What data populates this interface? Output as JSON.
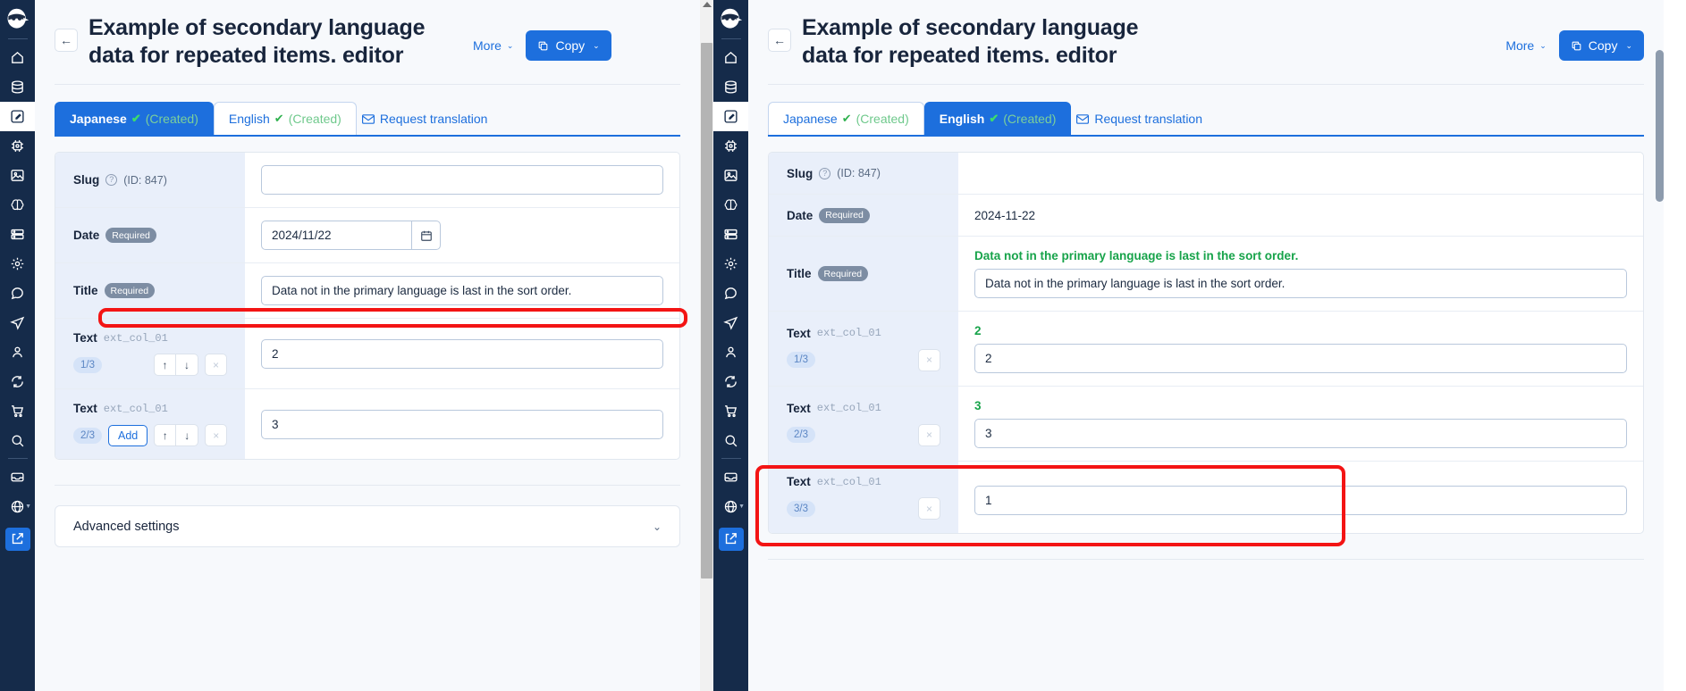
{
  "sidebar": {
    "logo": "ninja-logo",
    "items": [
      {
        "icon": "home-icon",
        "name": "home",
        "active": false
      },
      {
        "icon": "database-icon",
        "name": "database",
        "active": false
      },
      {
        "icon": "edit-square-icon",
        "name": "editor",
        "active": true
      },
      {
        "icon": "chip-icon",
        "name": "chip",
        "active": false
      },
      {
        "icon": "image-icon",
        "name": "media",
        "active": false
      },
      {
        "icon": "brain-icon",
        "name": "ai",
        "active": false
      },
      {
        "icon": "server-icon",
        "name": "server",
        "active": false
      },
      {
        "icon": "gear-icon",
        "name": "settings",
        "active": false
      },
      {
        "icon": "chat-icon",
        "name": "chat",
        "active": false
      },
      {
        "icon": "send-icon",
        "name": "send",
        "active": false
      },
      {
        "icon": "user-icon",
        "name": "user",
        "active": false
      },
      {
        "icon": "sync-icon",
        "name": "sync",
        "active": false
      },
      {
        "icon": "cart-icon",
        "name": "cart",
        "active": false
      },
      {
        "icon": "search-icon",
        "name": "search",
        "active": false
      },
      {
        "icon": "inbox-icon",
        "name": "inbox",
        "active": false
      },
      {
        "icon": "globe-icon",
        "name": "language",
        "active": false
      },
      {
        "icon": "external-link-icon",
        "name": "open-external",
        "active": false
      }
    ]
  },
  "header": {
    "title": "Example of secondary language data for repeated items. editor",
    "back_label": "←",
    "more_label": "More",
    "more_chevron": "⌄",
    "copy_label": "Copy",
    "copy_chevron": "⌄"
  },
  "tabs": {
    "japanese": {
      "label": "Japanese",
      "check": "✔",
      "status": "(Created)"
    },
    "english": {
      "label": "English",
      "check": "✔",
      "status": "(Created)"
    },
    "request": {
      "label": "Request translation"
    }
  },
  "left_panel": {
    "active_tab": "Japanese",
    "rows": [
      {
        "label": "Slug",
        "help": "?",
        "id_text": "(ID: 847)",
        "required": false,
        "value": "",
        "kind": "text"
      },
      {
        "label": "Date",
        "required_badge": "Required",
        "value": "2024/11/22",
        "kind": "date"
      },
      {
        "label": "Title",
        "required_badge": "Required",
        "value": "Data not in the primary language is last in the sort order.",
        "kind": "text"
      },
      {
        "label": "Text",
        "code": "ext_col_01",
        "index": "1/3",
        "add_label": null,
        "up": "↑",
        "down": "↓",
        "remove": "×",
        "value": "2",
        "kind": "repeat"
      },
      {
        "label": "Text",
        "code": "ext_col_01",
        "index": "2/3",
        "add_label": "Add",
        "up": "↑",
        "down": "↓",
        "remove": "×",
        "value": "3",
        "kind": "repeat"
      }
    ],
    "advanced_settings": {
      "title": "Advanced settings",
      "chevron": "⌄"
    }
  },
  "right_panel": {
    "active_tab": "English",
    "rows": [
      {
        "label": "Slug",
        "help": "?",
        "id_text": "(ID: 847)",
        "value": "",
        "kind": "readonly"
      },
      {
        "label": "Date",
        "required_badge": "Required",
        "value": "2024-11-22",
        "kind": "readonly"
      },
      {
        "label": "Title",
        "required_badge": "Required",
        "reference": "Data not in the primary language is last in the sort order.",
        "value": "Data not in the primary language is last in the sort order.",
        "kind": "translate"
      },
      {
        "label": "Text",
        "code": "ext_col_01",
        "index": "1/3",
        "remove": "×",
        "reference": "2",
        "value": "2",
        "kind": "translate-repeat"
      },
      {
        "label": "Text",
        "code": "ext_col_01",
        "index": "2/3",
        "remove": "×",
        "reference": "3",
        "value": "3",
        "kind": "translate-repeat"
      },
      {
        "label": "Text",
        "code": "ext_col_01",
        "index": "3/3",
        "remove": "×",
        "reference": "",
        "value": "1",
        "kind": "translate-repeat",
        "highlighted": true
      }
    ]
  },
  "colors": {
    "accent_blue": "#1d6fdd",
    "sidebar_navy": "#152b4a",
    "green_reference": "#17a34a",
    "highlight_red": "#f31414",
    "label_bg": "#e9effa"
  }
}
